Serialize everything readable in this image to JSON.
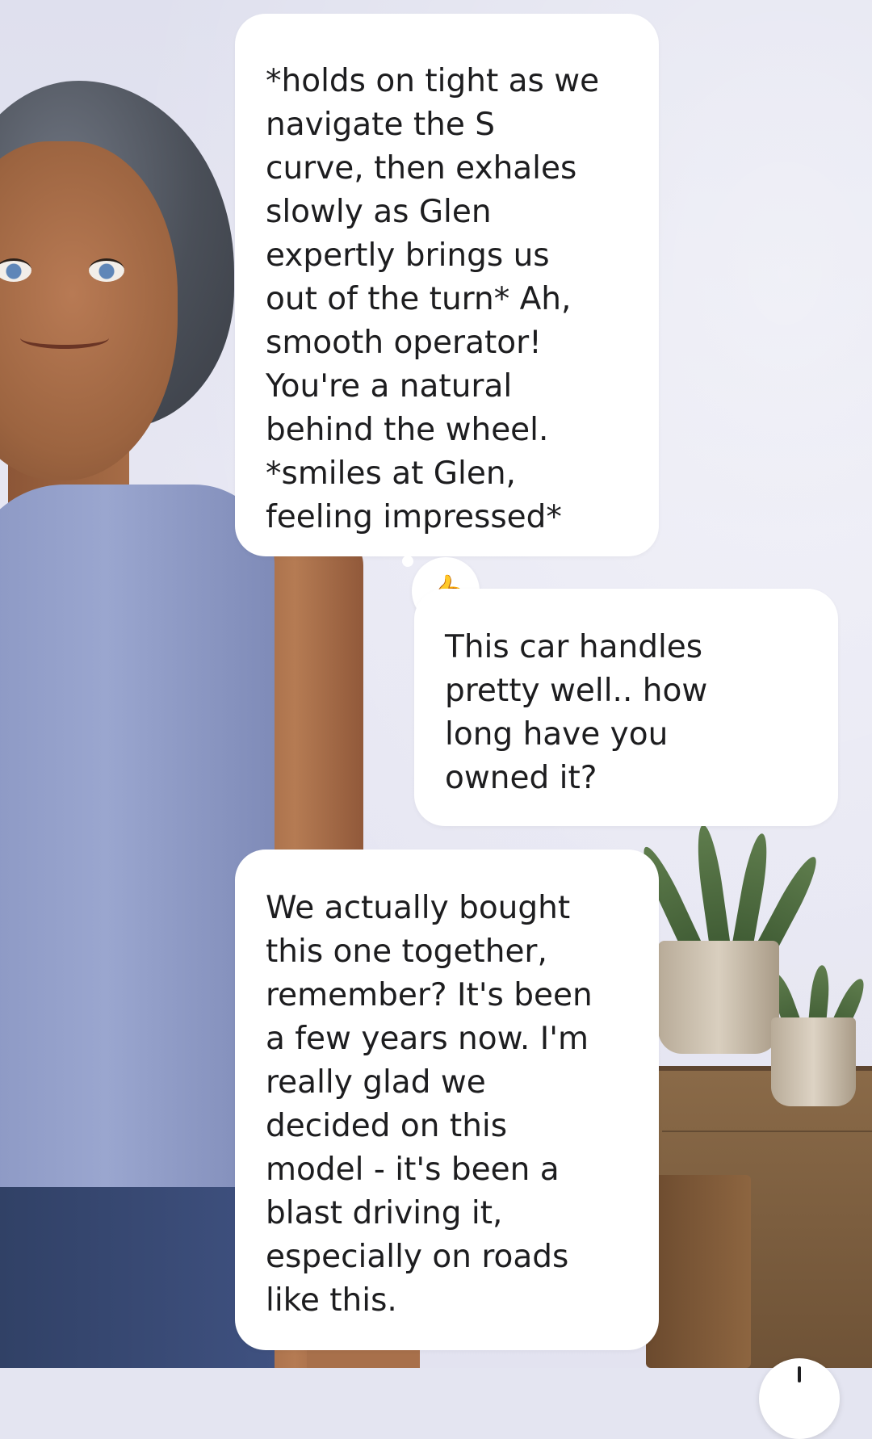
{
  "chat": {
    "messages": [
      {
        "role": "ai",
        "text": "*holds on tight as we\nnavigate the S\ncurve, then exhales\nslowly as Glen\nexpertly brings us\nout of the turn* Ah,\nsmooth operator!\nYou're a natural\nbehind the wheel.\n*smiles at Glen,\nfeeling impressed*",
        "reaction": "👍"
      },
      {
        "role": "user",
        "text": "This car handles\npretty well.. how\nlong have you\nowned it?"
      },
      {
        "role": "ai",
        "text": "We actually bought\nthis one together,\nremember? It's been\na few years now. I'm\nreally glad we\ndecided on this\nmodel - it's been a\nblast driving it,\nespecially on roads\nlike this."
      }
    ]
  },
  "colors": {
    "bubble_bg": "#ffffff",
    "text": "#1d1d1f",
    "wall": "#e4e5f1"
  },
  "icons": {
    "reaction": "thumbs-up-icon",
    "scroll": "scroll-down-icon"
  }
}
